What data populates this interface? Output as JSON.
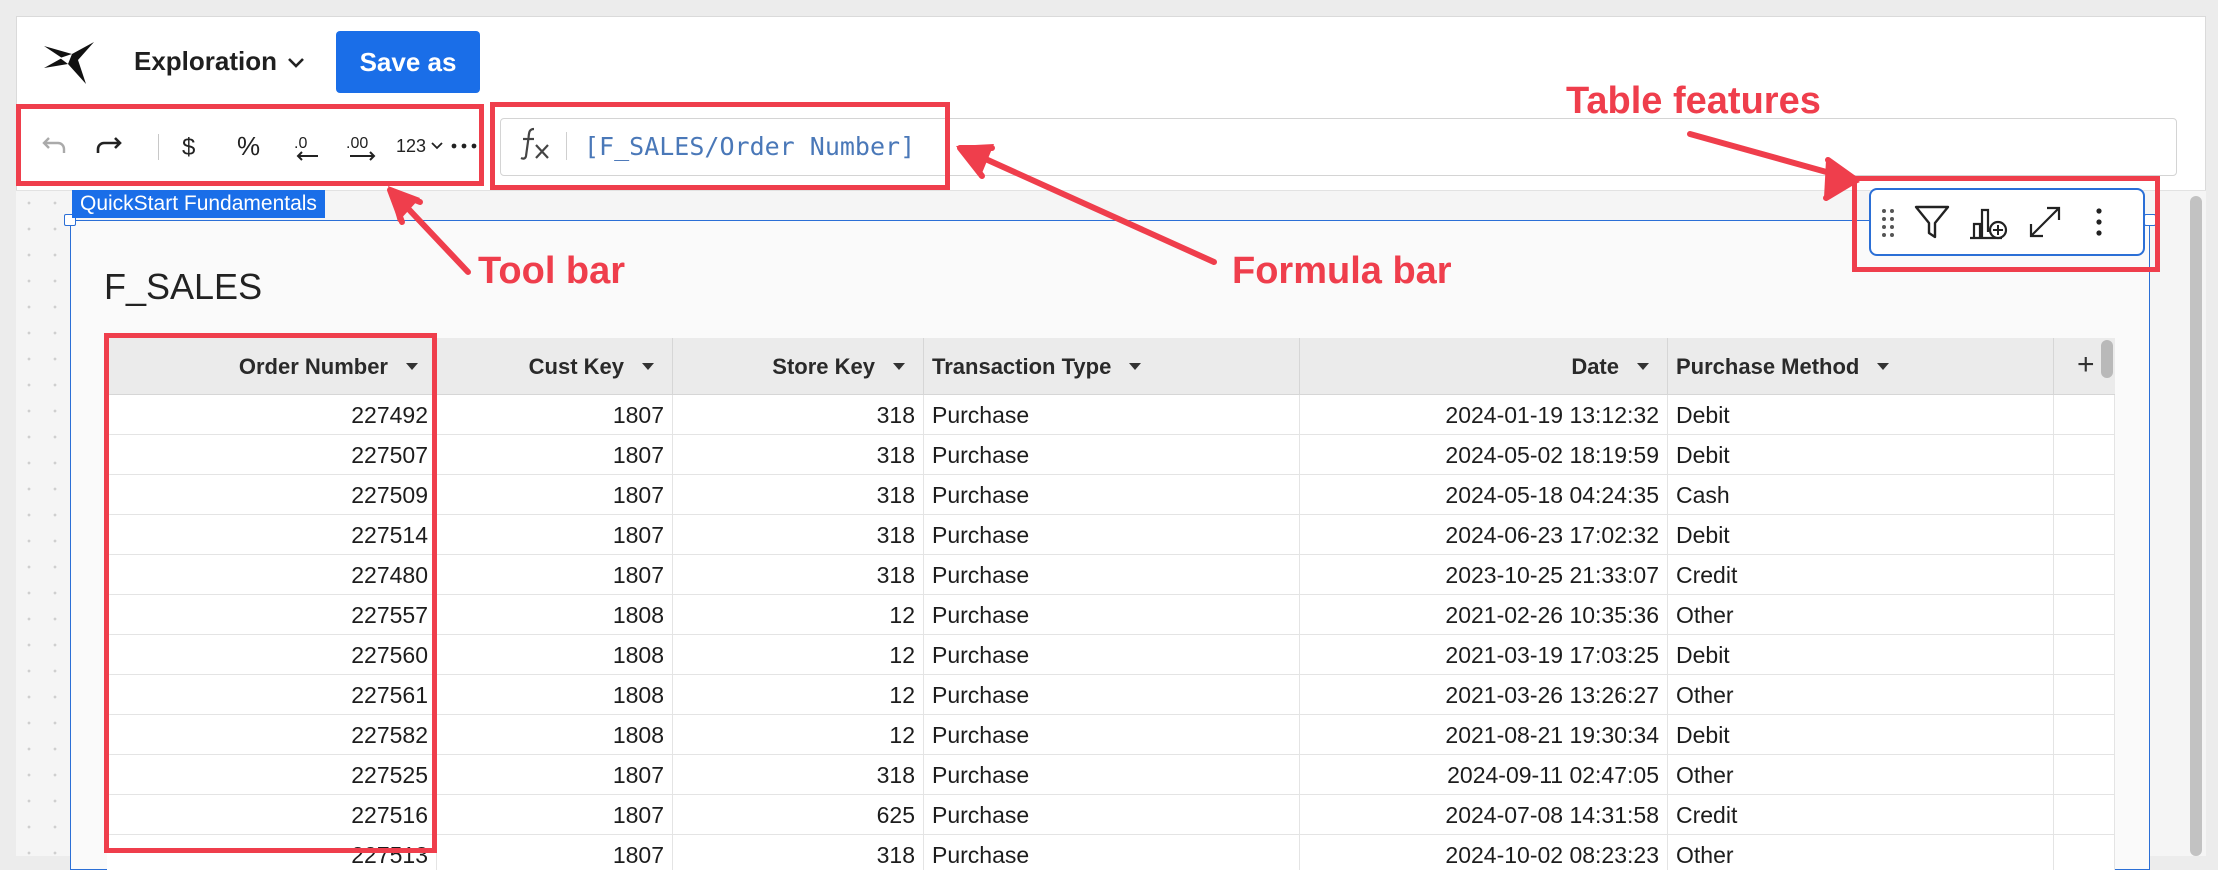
{
  "header": {
    "workbook_name": "Exploration",
    "save_button": "Save as"
  },
  "toolbar": {
    "format_number_label": "123"
  },
  "formula_bar": {
    "fx_symbol": "fx",
    "formula": "[F_SALES/Order Number]"
  },
  "workspace_tag": "QuickStart Fundamentals",
  "table": {
    "title": "F_SALES",
    "columns": [
      "Order Number",
      "Cust Key",
      "Store Key",
      "Transaction Type",
      "Date",
      "Purchase Method"
    ],
    "rows": [
      [
        "227492",
        "1807",
        "318",
        "Purchase",
        "2024-01-19 13:12:32",
        "Debit"
      ],
      [
        "227507",
        "1807",
        "318",
        "Purchase",
        "2024-05-02 18:19:59",
        "Debit"
      ],
      [
        "227509",
        "1807",
        "318",
        "Purchase",
        "2024-05-18 04:24:35",
        "Cash"
      ],
      [
        "227514",
        "1807",
        "318",
        "Purchase",
        "2024-06-23 17:02:32",
        "Debit"
      ],
      [
        "227480",
        "1807",
        "318",
        "Purchase",
        "2023-10-25 21:33:07",
        "Credit"
      ],
      [
        "227557",
        "1808",
        "12",
        "Purchase",
        "2021-02-26 10:35:36",
        "Other"
      ],
      [
        "227560",
        "1808",
        "12",
        "Purchase",
        "2021-03-19 17:03:25",
        "Debit"
      ],
      [
        "227561",
        "1808",
        "12",
        "Purchase",
        "2021-03-26 13:26:27",
        "Other"
      ],
      [
        "227582",
        "1808",
        "12",
        "Purchase",
        "2021-08-21 19:30:34",
        "Debit"
      ],
      [
        "227525",
        "1807",
        "318",
        "Purchase",
        "2024-09-11 02:47:05",
        "Other"
      ],
      [
        "227516",
        "1807",
        "625",
        "Purchase",
        "2024-07-08 14:31:58",
        "Credit"
      ],
      [
        "227513",
        "1807",
        "318",
        "Purchase",
        "2024-10-02 08:23:23",
        "Other"
      ]
    ]
  },
  "annotations": {
    "tool_bar": "Tool bar",
    "formula_bar": "Formula bar",
    "table_features": "Table features",
    "color": "#ef3e4c"
  },
  "colors": {
    "accent": "#1a6ee8",
    "selection": "#2b6fd6"
  }
}
